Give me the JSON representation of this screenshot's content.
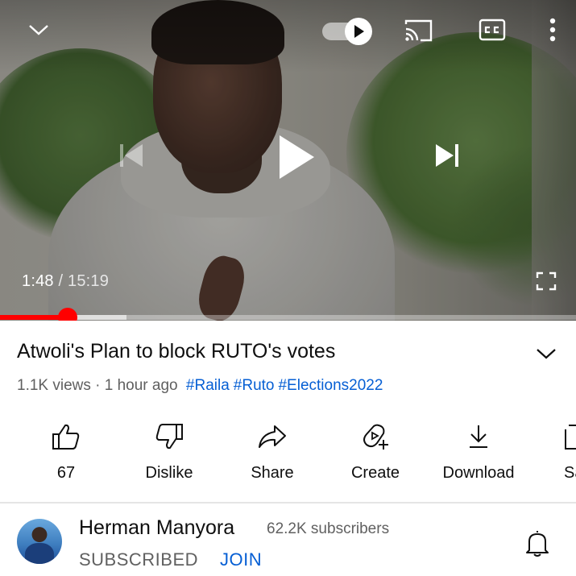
{
  "player": {
    "current_time": "1:48",
    "separator": " / ",
    "duration": "15:19",
    "progress_fraction": 0.117,
    "buffered_fraction": 0.22,
    "autoplay_on": true,
    "icons": {
      "collapse": "chevron-down-icon",
      "autoplay": "autoplay-toggle-icon",
      "cast": "cast-icon",
      "captions": "closed-captions-icon",
      "more": "more-vert-icon",
      "previous": "skip-previous-icon",
      "play": "play-icon",
      "next": "skip-next-icon",
      "fullscreen": "fullscreen-icon"
    }
  },
  "video": {
    "title": "Atwoli's Plan to block RUTO's votes",
    "views": "1.1K views",
    "dot": " · ",
    "age": "1 hour ago",
    "hashtags": [
      "#Raila",
      "#Ruto",
      "#Elections2022"
    ]
  },
  "actions": [
    {
      "label": "67",
      "icon": "thumbs-up-icon"
    },
    {
      "label": "Dislike",
      "icon": "thumbs-down-icon"
    },
    {
      "label": "Share",
      "icon": "share-icon"
    },
    {
      "label": "Create",
      "icon": "create-icon"
    },
    {
      "label": "Download",
      "icon": "download-icon"
    },
    {
      "label": "Sa",
      "icon": "save-icon"
    }
  ],
  "channel": {
    "name": "Herman Manyora",
    "subscribers": "62.2K subscribers",
    "subscribed_label": "SUBSCRIBED",
    "join_label": "JOIN",
    "bell_icon": "bell-icon"
  },
  "colors": {
    "progress": "#ff0000",
    "link": "#065fd4",
    "text_primary": "#0f0f0f",
    "text_secondary": "#606060"
  }
}
